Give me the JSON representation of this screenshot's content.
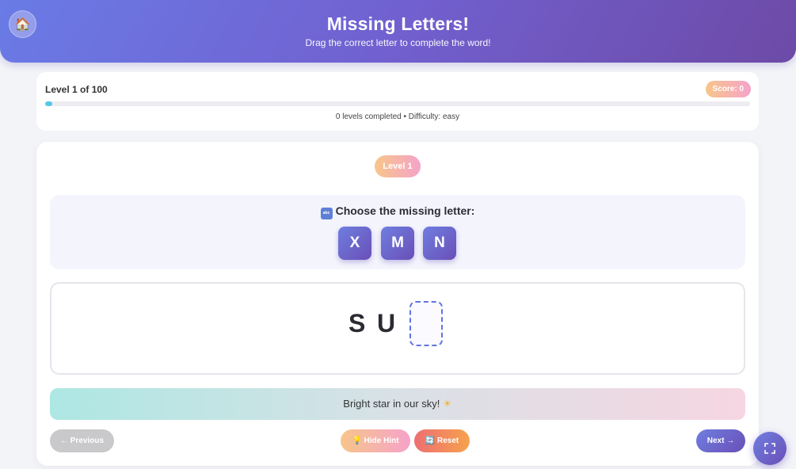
{
  "header": {
    "title": "Missing Letters!",
    "subtitle": "Drag the correct letter to complete the word!",
    "home_icon": "house-icon"
  },
  "progress": {
    "level_text": "Level 1 of 100",
    "score_text": "Score: 0",
    "fraction": 0.01,
    "subtitle": "0 levels completed • Difficulty: easy"
  },
  "game": {
    "level_label": "Level 1",
    "choices_title": "Choose the missing letter:",
    "choices_icon": "abc-icon",
    "choices": [
      "X",
      "M",
      "N"
    ],
    "word": [
      "S",
      "U"
    ],
    "hint": "Bright star in our sky!",
    "hint_icon": "sun-icon"
  },
  "controls": {
    "previous_label": "← Previous",
    "hint_label": "Hide Hint",
    "reset_label": "Reset",
    "next_label": "Next →"
  },
  "colors": {
    "header_start": "#6a7be6",
    "header_end": "#6d4aa6",
    "tile": "#6a5fcf",
    "slot_border": "#6273e0",
    "progress_fill": "#55c8e6"
  }
}
